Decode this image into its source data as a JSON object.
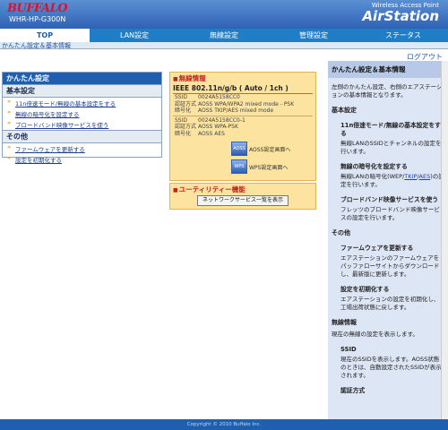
{
  "header": {
    "logo": "BUFFALO",
    "model": "WHR-HP-G300N",
    "brand_small": "Wireless Access Point",
    "brand_big": "AirStation"
  },
  "tabs": [
    "TOP",
    "LAN設定",
    "無線設定",
    "管理設定",
    "ステータス"
  ],
  "breadcrumb": "かんたん設定＆基本情報",
  "logout": "ログアウト",
  "left": {
    "title": "かんたん設定",
    "sec1": "基本設定",
    "links1": [
      "11n倍速モード/無線の基本設定をする",
      "無線の暗号化を設定する",
      "ブロードバンド映像サービスを使う"
    ],
    "sec2": "その他",
    "links2": [
      "ファームウェアを更新する",
      "設定を初期化する"
    ]
  },
  "wireless": {
    "title": "無線情報",
    "ieee": "IEEE 802.11n/g/b ( Auto / 1ch )",
    "r1k": "SSID",
    "r1v": "0024A5158CC0",
    "r2k": "認証方式",
    "r2v": "AOSS WPA/WPA2 mixed mode - PSK",
    "r3k": "暗号化",
    "r3v": "AOSS TKIP/AES mixed mode",
    "r4k": "SSID",
    "r4v": "0024A5158CC0-1",
    "r5k": "認証方式",
    "r5v": "AOSS WPA-PSK",
    "r6k": "暗号化",
    "r6v": "AOSS AES",
    "aoss": "AOSS設定画面へ",
    "wps": "WPS設定画面へ",
    "aoss_icon": "AOSS",
    "wps_icon": "WPS"
  },
  "utility": {
    "title": "ユーティリティー機能",
    "button": "ネットワークサービス一覧を表示"
  },
  "help": {
    "title": "かんたん設定＆基本情報",
    "intro": "左側のかんたん設定、右側のエアステーションの基本情報となります。",
    "h1": "基本設定",
    "s1": "11n倍速モード/無線の基本設定をする",
    "t1": "無線LANのSSIDとチャンネルの設定を行います。",
    "s2": "無線の暗号化を設定する",
    "t2a": "無線LANの暗号化(WEP/",
    "t2l1": "TKIP",
    "t2sep": "/",
    "t2l2": "AES",
    "t2b": ")の設定を行います。",
    "s3": "ブロードバンド映像サービスを使う",
    "t3": "フレッツのブロードバンド映像サービスの設定を行います。",
    "h2": "その他",
    "s4": "ファームウェアを更新する",
    "t4": "エアステーションのファームウェアをパッファローサイトからダウンロードし、最新版に更新します。",
    "s5": "設定を初期化する",
    "t5": "エアステーションの設定を初期化し、工場出荷状態に戻します。",
    "h3": "無線情報",
    "t6": "現在の無線の設定を表示します。",
    "s6": "SSID",
    "t7": "現在のSSIDを表示します。AOSS状態のときは、自動設定されたSSIDが表示されます。",
    "s7": "認証方式"
  },
  "footer": "Copyright © 2010 Buffalo Inc."
}
